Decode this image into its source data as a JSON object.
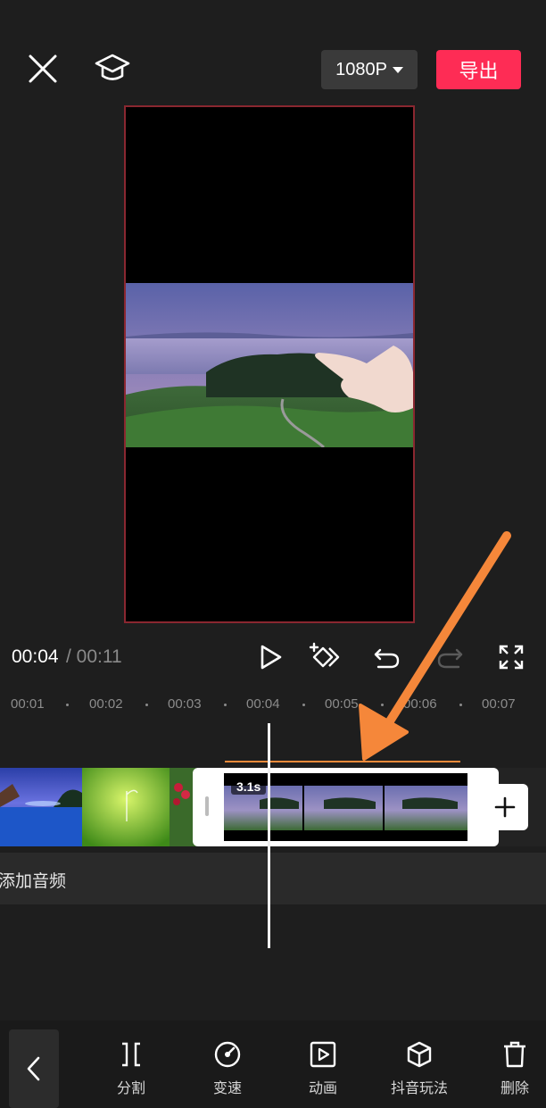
{
  "header": {
    "resolution_label": "1080P",
    "export_label": "导出"
  },
  "preview": {
    "current_time": "00:04",
    "total_time": " / 00:11"
  },
  "ruler": {
    "ticks": [
      "00:01",
      "00:02",
      "00:03",
      "00:04",
      "00:05",
      "00:06",
      "00:07"
    ]
  },
  "timeline": {
    "thumb_1_caption": "",
    "thumb_2_caption": "",
    "selected_clip_duration": "3.1s",
    "audio_label": "添加音频"
  },
  "toolbar": {
    "split": "分割",
    "speed": "变速",
    "animation": "动画",
    "douyin_effects": "抖音玩法",
    "delete": "删除"
  },
  "colors": {
    "accent": "#fe2c55",
    "annotation_arrow": "#f5873a",
    "canvas_border": "#8a2730"
  }
}
